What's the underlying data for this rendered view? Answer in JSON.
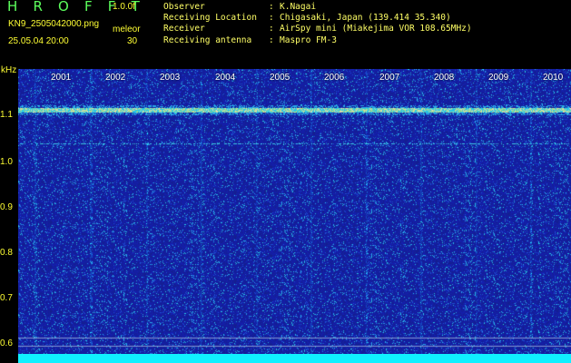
{
  "header": {
    "app_title": "H R O F F T",
    "version": "1.0.0f",
    "filename": "KN9_2505042000.png",
    "mode": "meleor",
    "datetime": "25.05.04 20:00",
    "number": "30",
    "observer_label": "Observer",
    "observer_value": "K.Nagai",
    "location_label": "Receiving Location",
    "location_value": "Chigasaki, Japan (139.414 35.340)",
    "receiver_label": "Receiver",
    "receiver_value": "AirSpy mini (Miakejima VOR 108.65MHz)",
    "antenna_label": "Receiving antenna",
    "antenna_value": "Maspro FM-3",
    "colon": ":"
  },
  "plot": {
    "unit": "kHz",
    "y_ticks": [
      "1.1",
      "1.0",
      "0.9",
      "0.8",
      "0.7",
      "0.6"
    ],
    "x_ticks": [
      "2001",
      "2002",
      "2003",
      "2004",
      "2005",
      "2006",
      "2007",
      "2008",
      "2009",
      "2010"
    ]
  },
  "colors": {
    "background": "#1b2a9a",
    "text_yellow": "#ffff33",
    "title_green": "#5cff5c",
    "bottom_bar": "#10f0ff"
  }
}
